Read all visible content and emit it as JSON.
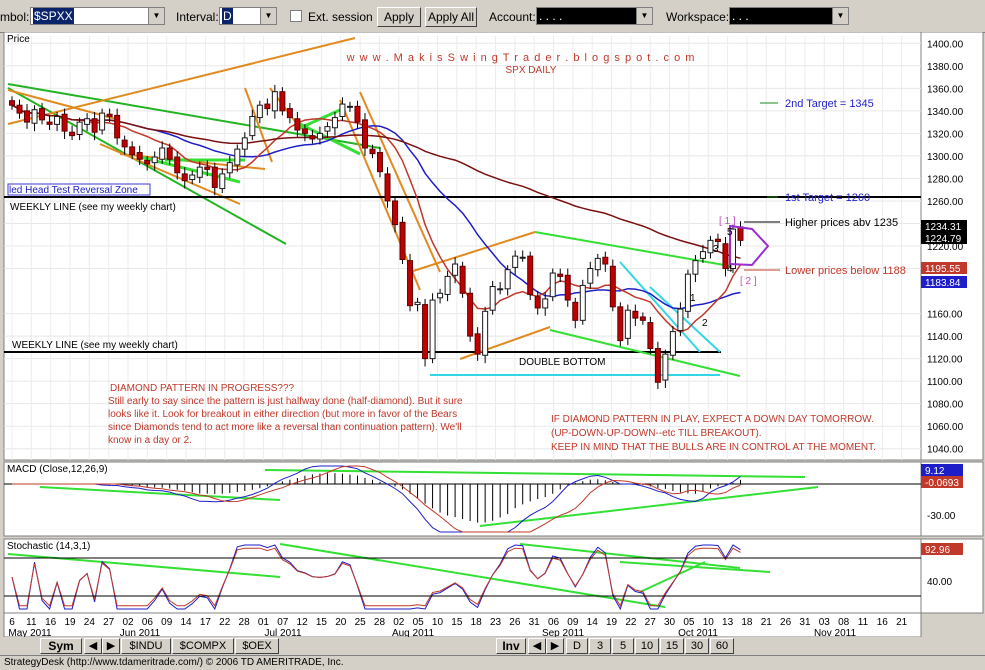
{
  "toolbar": {
    "symbol_label": "mbol:",
    "symbol_value": "$SPXX",
    "interval_label": "Interval:",
    "interval_value": "D",
    "ext_session_label": "Ext. session",
    "apply_label": "Apply",
    "apply_all_label": "Apply All",
    "account_label": "Account:",
    "account_value": ".   .   .   .",
    "workspace_label": "Workspace:",
    "workspace_value": ".   .   ."
  },
  "chart_data": [
    {
      "type": "candlestick",
      "panel": "price",
      "title": "SPX DAILY",
      "subtitle": "w w w . M a k i s S w i n g T r a d e r . b l o g s p o t . c o m",
      "ylabel": "Price",
      "ylim": [
        1030,
        1410
      ],
      "yticks": [
        1040,
        1060,
        1080,
        1100,
        1120,
        1140,
        1160,
        1180,
        1200,
        1220,
        1240,
        1260,
        1280,
        1300,
        1320,
        1340,
        1360,
        1380,
        1400
      ],
      "tick_labels_shown": [
        "1040.00",
        "1060.00",
        "1080.00",
        "1100.00",
        "1120.00",
        "1140.00",
        "1160.00",
        "1200.00",
        "1220.00",
        "1240.00",
        "1260.00",
        "1280.00",
        "1300.00",
        "1320.00",
        "1340.00",
        "1360.00",
        "1380.00",
        "1400.00"
      ],
      "price_badges": [
        {
          "value": "1234.31",
          "color": "#000000"
        },
        {
          "value": "1224.79",
          "color": "#000000"
        },
        {
          "value": "1195.55",
          "color": "#c0392b"
        },
        {
          "value": "1183.84",
          "color": "#1e1ec8"
        }
      ],
      "horizontal_lines": [
        {
          "y": 1261,
          "label": "WEEKLY LINE (see my weekly chart)",
          "color": "#000000"
        },
        {
          "y": 1119,
          "label": "WEEKLY LINE (see my weekly chart)",
          "color": "#000000"
        }
      ],
      "zone_label": "led Head Test Reversal Zone",
      "double_bottom_label": "DOUBLE BOTTOM",
      "annotations": {
        "target2": "2nd Target = 1345",
        "target1": "1st Target = 1260",
        "higher": "Higher prices abv 1235",
        "lower": "Lower prices below 1188",
        "diamond_title": "DIAMOND PATTERN IN PROGRESS???",
        "diamond_body": "Still early to say since the pattern is just halfway done (half-diamond). But it sure looks like it. Look for breakout in either direction (but more in favor of the Bears since Diamonds tend to act more like a reversal than continuation pattern). We'll know in a day or 2.",
        "play_line1": "IF DIAMOND PATTERN IN PLAY, EXPECT A DOWN DAY TOMORROW.",
        "play_line2": "(UP-DOWN-UP-DOWN--etc TILL BREAKOUT).",
        "play_line3": "KEEP IN MIND THAT THE BULLS ARE IN CONTROL AT THE MOMENT.",
        "bracket1": "[ 1 ]",
        "bracket2": "[ 2 ]"
      },
      "wave_labels": [
        "1",
        "2",
        "3",
        "4",
        "5"
      ],
      "closes": [
        1345,
        1338,
        1330,
        1341,
        1332,
        1328,
        1335,
        1322,
        1318,
        1330,
        1333,
        1321,
        1338,
        1335,
        1316,
        1308,
        1301,
        1297,
        1293,
        1299,
        1307,
        1297,
        1285,
        1278,
        1283,
        1290,
        1288,
        1272,
        1284,
        1294,
        1306,
        1316,
        1335,
        1345,
        1342,
        1357,
        1340,
        1334,
        1323,
        1320,
        1315,
        1320,
        1326,
        1334,
        1346,
        1344,
        1330,
        1307,
        1302,
        1286,
        1260,
        1239,
        1208,
        1167,
        1170,
        1120,
        1172,
        1178,
        1193,
        1204,
        1178,
        1140,
        1124,
        1162,
        1184,
        1182,
        1199,
        1211,
        1210,
        1177,
        1165,
        1173,
        1196,
        1193,
        1172,
        1154,
        1185,
        1200,
        1209,
        1204,
        1166,
        1136,
        1163,
        1156,
        1154,
        1129,
        1099,
        1124,
        1144,
        1164,
        1195,
        1207,
        1215,
        1225,
        1224,
        1200,
        1235,
        1225
      ]
    },
    {
      "type": "line",
      "panel": "macd",
      "title": "MACD (Close,12,26,9)",
      "ylim": [
        -45,
        30
      ],
      "yticks_shown": [
        "-30.00"
      ],
      "series": [
        {
          "name": "MACD",
          "color": "#1e1ec8"
        },
        {
          "name": "Signal",
          "color": "#c0392b"
        }
      ],
      "last_values": [
        {
          "value": "9.12",
          "color": "#1e1ec8"
        },
        {
          "value": "-0.0693",
          "color": "#c0392b"
        }
      ]
    },
    {
      "type": "line",
      "panel": "stochastic",
      "title": "Stochastic (14,3,1)",
      "ylim": [
        0,
        100
      ],
      "yticks_shown": [
        "40.00"
      ],
      "last_value": {
        "value": "92.96",
        "color": "#c0392b"
      }
    }
  ],
  "x_axis": {
    "day_labels": [
      "6",
      "11",
      "16",
      "19",
      "24",
      "27",
      "02",
      "06",
      "09",
      "14",
      "17",
      "22",
      "28",
      "01",
      "07",
      "12",
      "15",
      "20",
      "25",
      "28",
      "02",
      "05",
      "10",
      "15",
      "18",
      "23",
      "26",
      "31",
      "06",
      "09",
      "14",
      "19",
      "22",
      "27",
      "30",
      "05",
      "10",
      "13",
      "18",
      "21",
      "26",
      "31",
      "03",
      "08",
      "11",
      "16",
      "21"
    ],
    "month_labels": [
      "May 2011",
      "Jun 2011",
      "Jul 2011",
      "Aug 2011",
      "Sep 2011",
      "Oct 2011",
      "Nov 2011"
    ]
  },
  "bottom_tabs": {
    "sym": "Sym",
    "indu": "$INDU",
    "compx": "$COMPX",
    "oex": "$OEX",
    "inv": "Inv",
    "intervals": [
      "D",
      "3",
      "5",
      "10",
      "15",
      "30",
      "60"
    ]
  },
  "status_text": "StrategyDesk (http://www.tdameritrade.com/) © 2006 TD AMERITRADE, Inc."
}
